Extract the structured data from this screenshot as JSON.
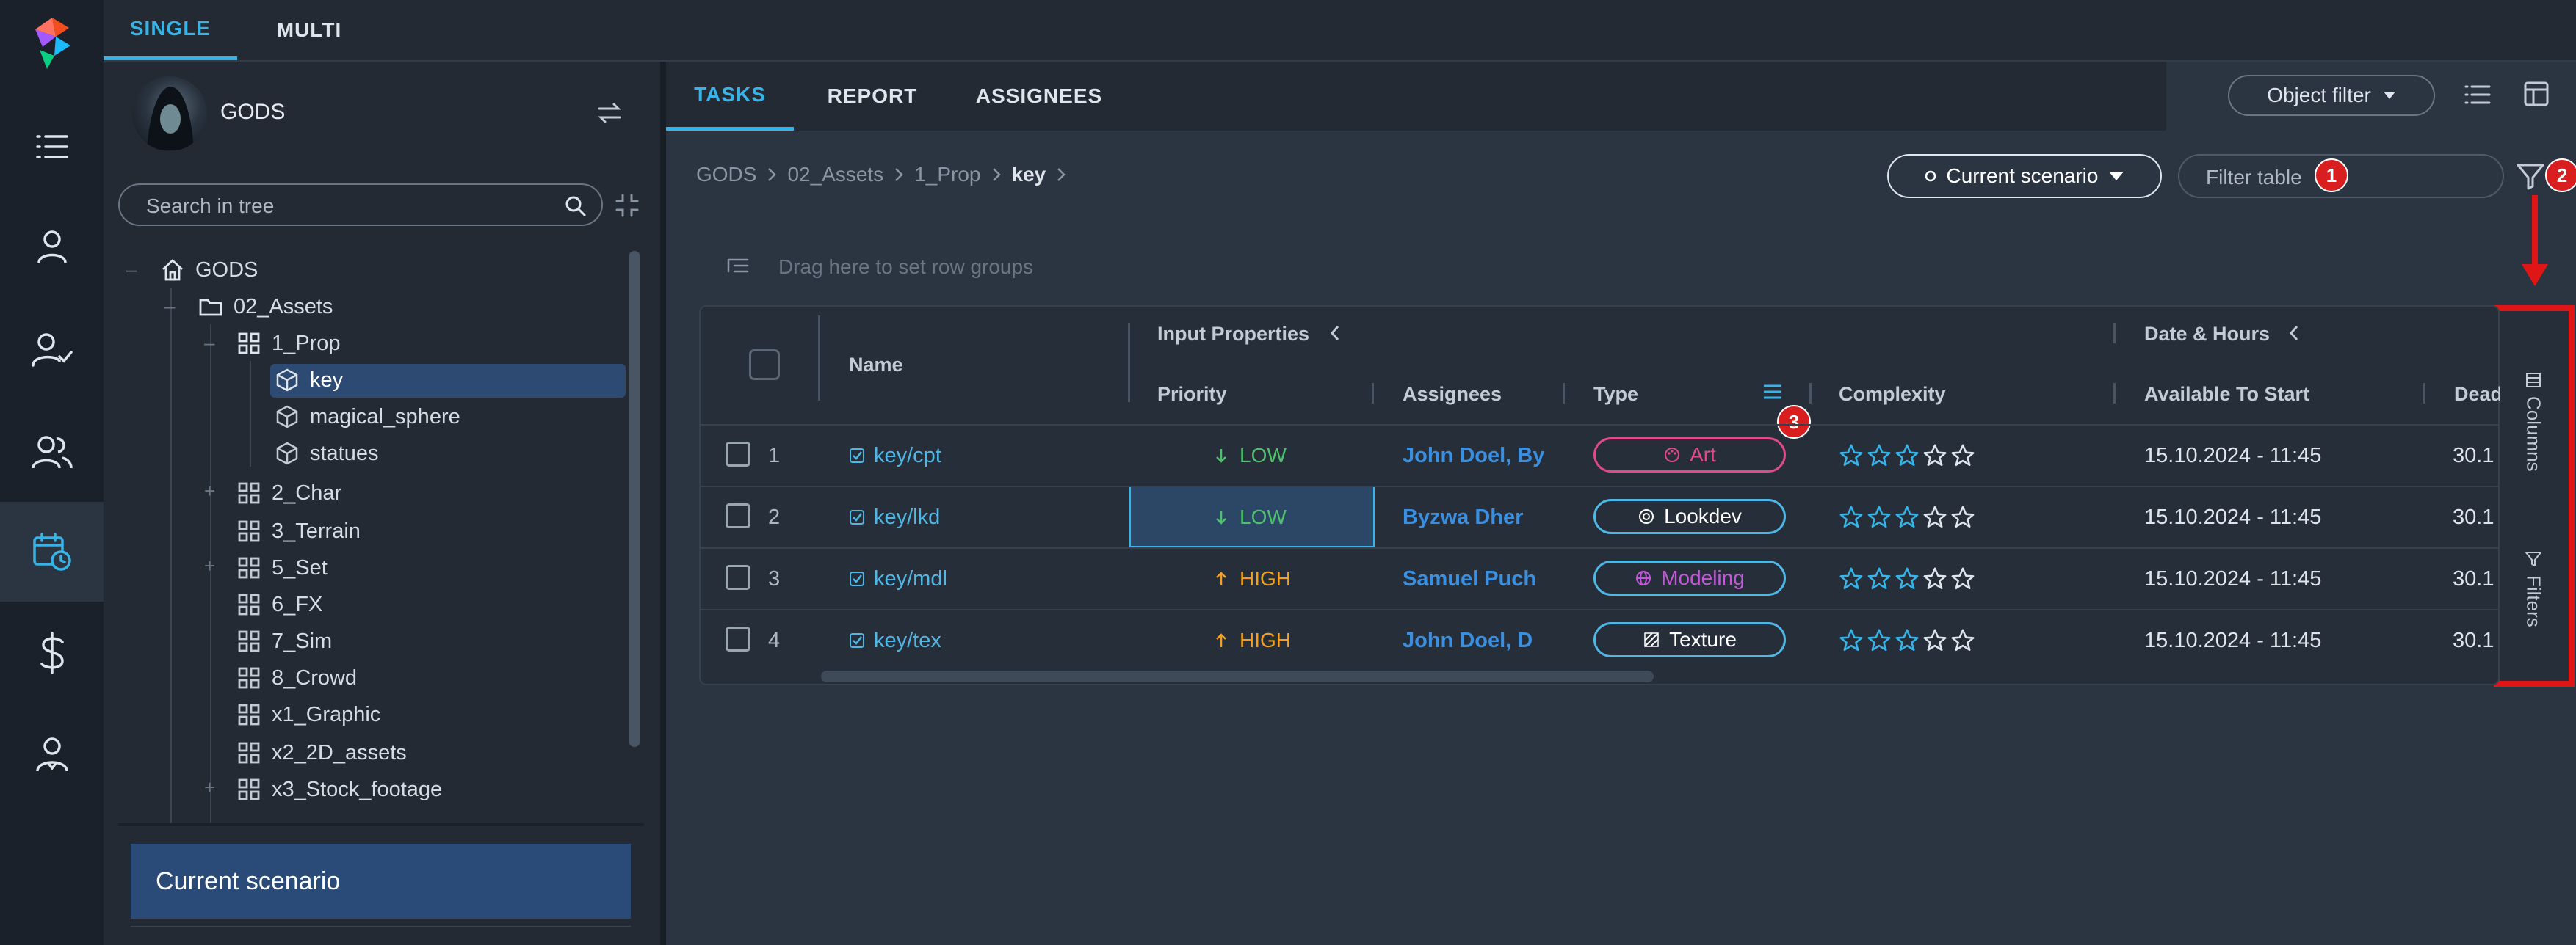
{
  "mode_tabs": {
    "single": "SINGLE",
    "multi": "MULTI"
  },
  "project": {
    "name": "GODS"
  },
  "tree_search": {
    "placeholder": "Search in tree"
  },
  "tree": {
    "root": "GODS",
    "assets": "02_Assets",
    "prop": "1_Prop",
    "items": [
      "key",
      "magical_sphere",
      "statues"
    ],
    "groups": [
      "2_Char",
      "3_Terrain",
      "5_Set",
      "6_FX",
      "7_Sim",
      "8_Crowd",
      "x1_Graphic",
      "x2_2D_assets",
      "x3_Stock_footage"
    ]
  },
  "scenario_panel": {
    "label": "Current scenario"
  },
  "main_tabs": {
    "tasks": "TASKS",
    "report": "REPORT",
    "assignees": "ASSIGNEES"
  },
  "object_filter": {
    "label": "Object filter"
  },
  "breadcrumb": [
    "GODS",
    "02_Assets",
    "1_Prop",
    "key"
  ],
  "scenario_button": {
    "label": "Current scenario"
  },
  "filter_table": {
    "placeholder": "Filter table"
  },
  "row_groups_hint": "Drag here to set row groups",
  "table": {
    "group_headers": {
      "input_properties": "Input Properties",
      "date_hours": "Date & Hours"
    },
    "columns": {
      "name": "Name",
      "priority": "Priority",
      "assignees": "Assignees",
      "type": "Type",
      "complexity": "Complexity",
      "available": "Available To Start",
      "deadline": "Dead"
    },
    "rows": [
      {
        "num": "1",
        "name": "key/cpt",
        "priority": "LOW",
        "assignees": "John Doel, By",
        "type": "Art",
        "stars": 3,
        "available": "15.10.2024 - 11:45",
        "deadline": "30.1"
      },
      {
        "num": "2",
        "name": "key/lkd",
        "priority": "LOW",
        "assignees": "Byzwa Dher",
        "type": "Lookdev",
        "stars": 3,
        "available": "15.10.2024 - 11:45",
        "deadline": "30.1"
      },
      {
        "num": "3",
        "name": "key/mdl",
        "priority": "HIGH",
        "assignees": "Samuel Puch",
        "type": "Modeling",
        "stars": 3,
        "available": "15.10.2024 - 11:45",
        "deadline": "30.1"
      },
      {
        "num": "4",
        "name": "key/tex",
        "priority": "HIGH",
        "assignees": "John Doel, D",
        "type": "Texture",
        "stars": 3,
        "available": "15.10.2024 - 11:45",
        "deadline": "30.1"
      }
    ]
  },
  "side_panel": {
    "columns": "Columns",
    "filters": "Filters"
  },
  "annotations": {
    "badge1": "1",
    "badge2": "2",
    "badge3": "3"
  },
  "colors": {
    "accent": "#36b4e8",
    "low": "#4cc26b",
    "high": "#f3a020",
    "art": "#e04a8a",
    "lookdev": "#4fb7e6",
    "modeling": "#c25ad8",
    "texture": "#4fb7e6",
    "highlight": "#e01515"
  }
}
